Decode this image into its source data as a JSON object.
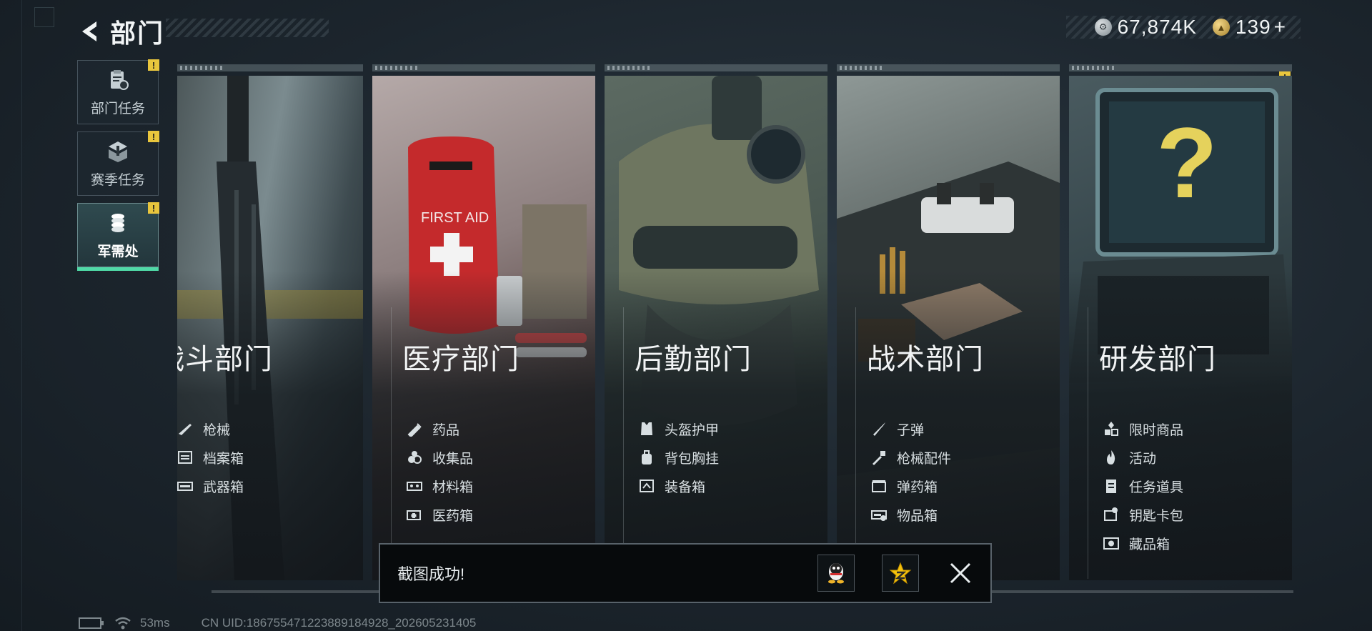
{
  "header": {
    "title": "部门"
  },
  "currency": {
    "silver": "67,874K",
    "gold": "139",
    "gold_plus": "+"
  },
  "tabs": [
    {
      "label": "部门任务",
      "badge": "!"
    },
    {
      "label": "赛季任务",
      "badge": "!"
    },
    {
      "label": "军需处",
      "badge": "!"
    }
  ],
  "departments": [
    {
      "name": "战斗部门",
      "items": [
        "枪械",
        "档案箱",
        "武器箱"
      ]
    },
    {
      "name": "医疗部门",
      "items": [
        "药品",
        "收集品",
        "材料箱",
        "医药箱"
      ]
    },
    {
      "name": "后勤部门",
      "items": [
        "头盔护甲",
        "背包胸挂",
        "装备箱"
      ]
    },
    {
      "name": "战术部门",
      "items": [
        "子弹",
        "枪械配件",
        "弹药箱",
        "物品箱"
      ]
    },
    {
      "name": "研发部门",
      "badge": "!",
      "items": [
        "限时商品",
        "活动",
        "任务道具",
        "钥匙卡包",
        "藏品箱"
      ]
    }
  ],
  "artwork_text": {
    "first_aid": "FIRST AID",
    "mystery": "?"
  },
  "toast": {
    "message": "截图成功!"
  },
  "footer": {
    "ping": "53ms",
    "uid": "CN UID:18675547122388918492​8_202605231405"
  },
  "colors": {
    "accent_green": "#4fd9a6",
    "badge_yellow": "#e9c63d"
  }
}
